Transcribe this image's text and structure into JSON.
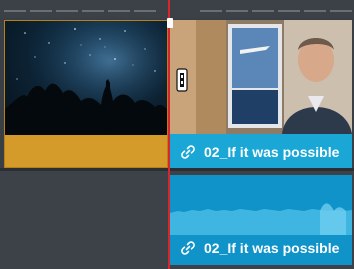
{
  "timeline": {
    "video_clips": [
      {
        "name": "",
        "color": "#d49a2a"
      },
      {
        "name": "02_If it was possible",
        "color": "#1ba7d6"
      }
    ],
    "audio_clips": [
      {
        "name": "02_If it was possible",
        "color": "#0f93c8"
      }
    ],
    "playhead_color": "#d8262b",
    "icons": {
      "clip_link": "link-icon",
      "trim_cursor": "trim-cursor-icon"
    }
  }
}
